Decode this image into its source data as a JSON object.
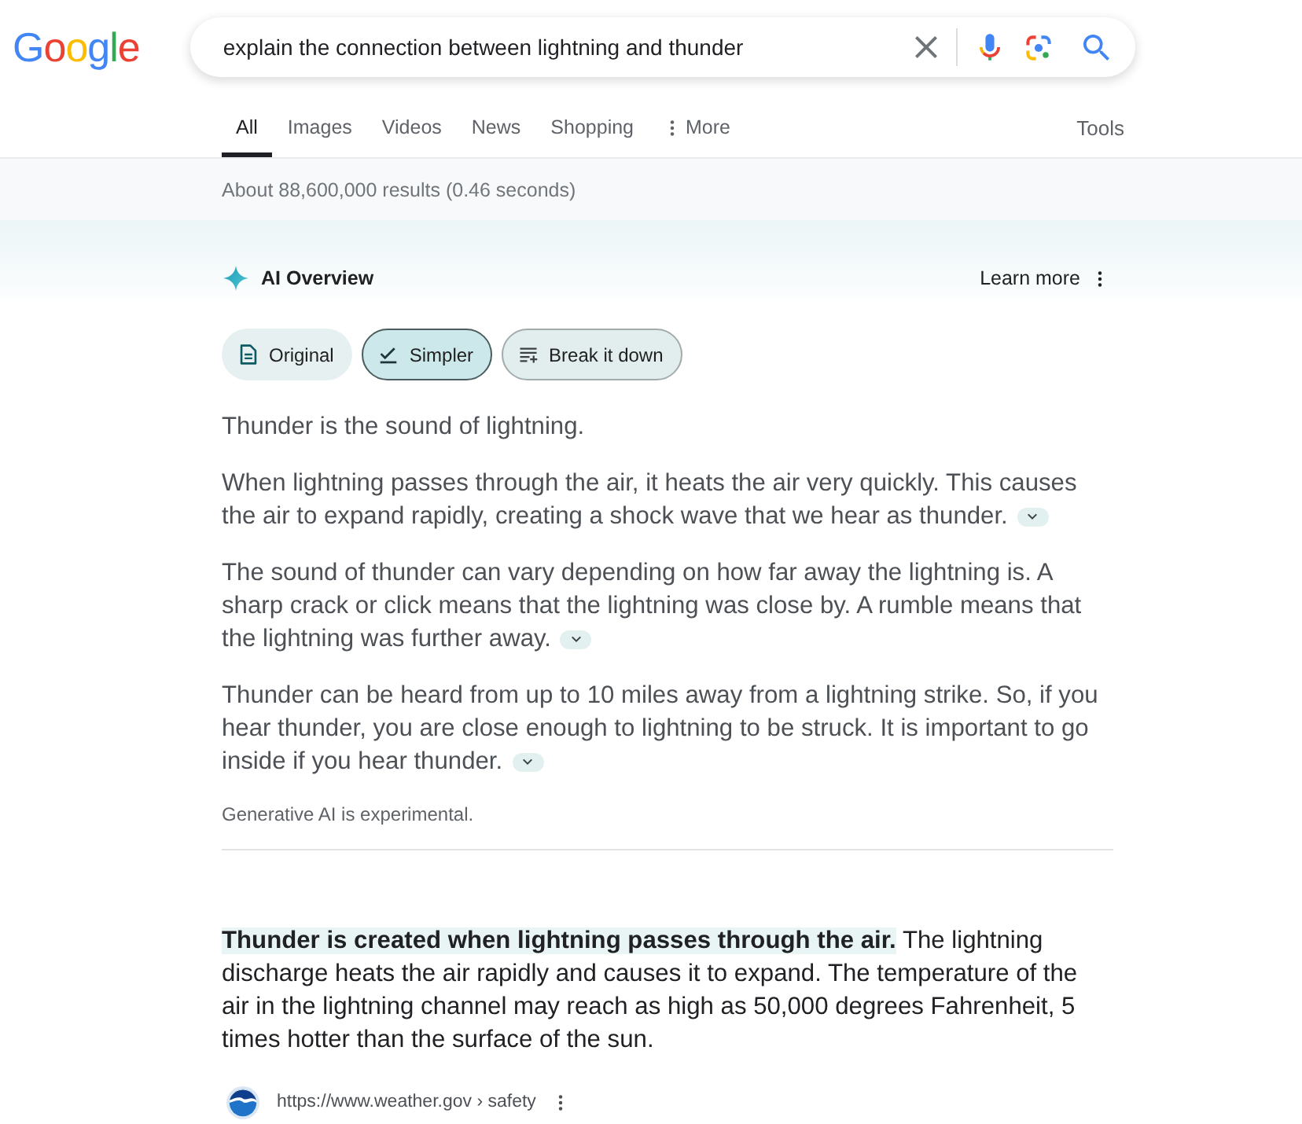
{
  "search": {
    "logo": "Google",
    "query": "explain the connection between lightning and thunder"
  },
  "tabs": [
    {
      "label": "All",
      "selected": true,
      "kind": "tab"
    },
    {
      "label": "Images",
      "selected": false,
      "kind": "tab"
    },
    {
      "label": "Videos",
      "selected": false,
      "kind": "tab"
    },
    {
      "label": "News",
      "selected": false,
      "kind": "tab"
    },
    {
      "label": "Shopping",
      "selected": false,
      "kind": "tab"
    },
    {
      "label": "More",
      "selected": false,
      "kind": "menu"
    }
  ],
  "tools": "Tools",
  "result_stats": "About 88,600,000 results (0.46 seconds)",
  "ai_overview": {
    "title": "AI Overview",
    "learn_more": "Learn more",
    "chips": [
      {
        "label": "Original",
        "kind": "original",
        "selected": false,
        "hovered": false
      },
      {
        "label": "Simpler",
        "kind": "simpler",
        "selected": true,
        "hovered": false
      },
      {
        "label": "Break it down",
        "kind": "breakdown",
        "selected": false,
        "hovered": true
      }
    ],
    "paragraphs": [
      {
        "text": "Thunder is the sound of lightning.",
        "expandable": false
      },
      {
        "text": "When lightning passes through the air, it heats the air very quickly. This causes the air to expand rapidly, creating a shock wave that we hear as thunder.",
        "expandable": true
      },
      {
        "text": "The sound of thunder can vary depending on how far away the lightning is. A sharp crack or click means that the lightning was close by. A rumble means that the lightning was further away.",
        "expandable": true
      },
      {
        "text": "Thunder can be heard from up to 10 miles away from a lightning strike. So, if you hear thunder, you are close enough to lightning to be struck. It is important to go inside if you hear thunder.",
        "expandable": true
      }
    ],
    "disclaimer": "Generative AI is experimental."
  },
  "featured_snippet": {
    "text": "**Thunder is created when lightning passes through the air.** The lightning discharge heats the air rapidly and causes it to expand. The temperature of the air in the lightning channel may reach as high as 50,000 degrees Fahrenheit, 5 times hotter than the surface of the sun.",
    "source": "https://www.weather.gov › safety"
  }
}
